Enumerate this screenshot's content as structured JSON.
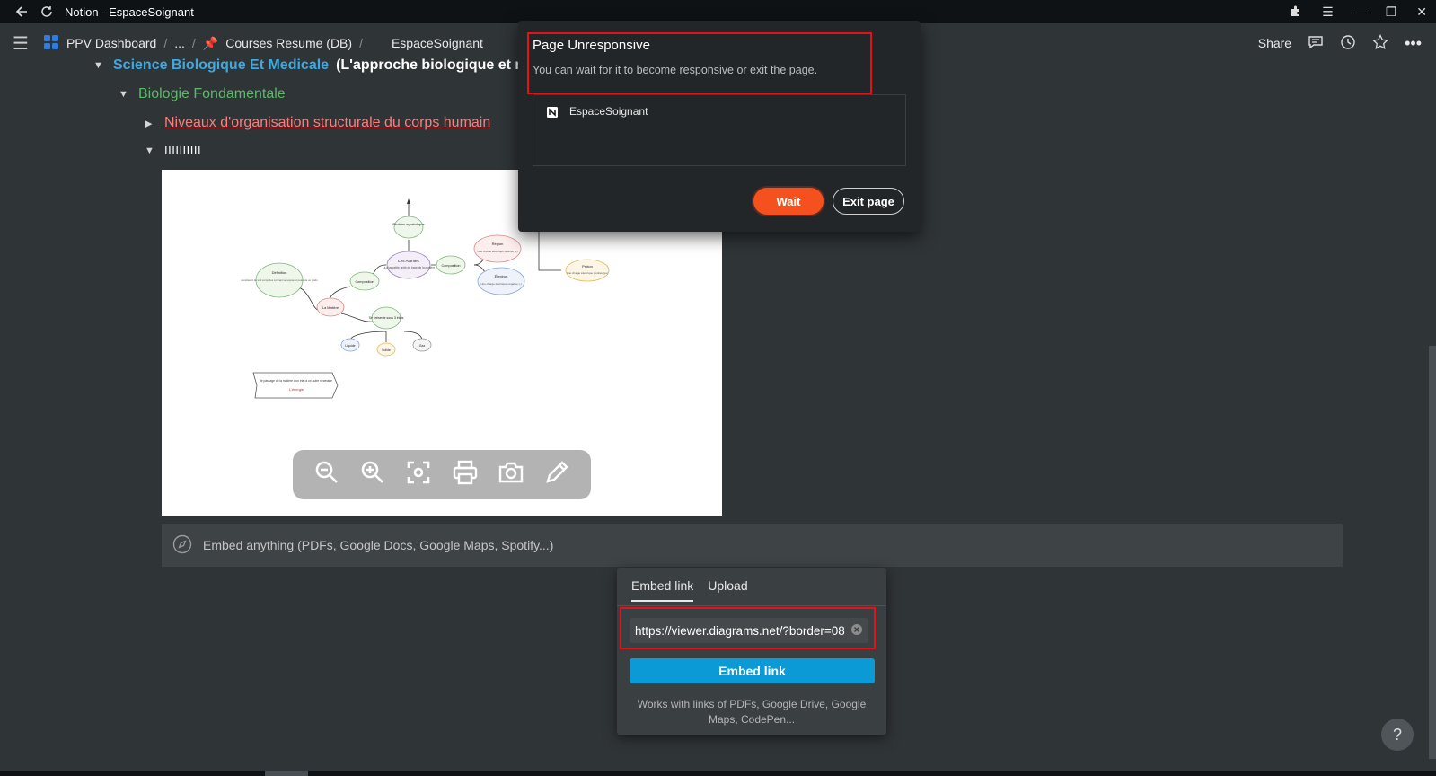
{
  "window": {
    "title": "Notion - EspaceSoignant"
  },
  "breadcrumb": {
    "workspace": "PPV Dashboard",
    "ellipsis": "...",
    "parent": "Courses Resume (DB)",
    "current": "EspaceSoignant"
  },
  "topbar": {
    "share_label": "Share"
  },
  "tree": {
    "row1_link": "Science Biologique Et Medicale",
    "row1_text": "(L'approche biologique et méd",
    "row2": "Biologie Fondamentale",
    "row3": "Niveaux d'organisation structurale du corps humain",
    "row4": "IIIIIIIIII"
  },
  "diagram": {
    "nodes": {
      "proton_top": "Protons symbolique",
      "atomes": "Les Atomes",
      "atomes_sub": "La plus petite unité de base de la matière",
      "composition_right": "Composition",
      "composition_left": "Composition",
      "region": "Région",
      "region_sub": "Une charge électrique positive (+)",
      "electron": "Électron",
      "electron_sub": "Une charge électrique négative (-)",
      "proton": "Proton",
      "proton_sub": "Une charge électrique positive (p+)",
      "definition": "Définition",
      "definition_sub": "constituant de tout corps des concept se repose et possède un poids",
      "matiere": "La Matière",
      "etats": "Se présente sous 3 états",
      "liquide": "Liquide",
      "solide": "Solide",
      "gaz": "Gaz",
      "note": "le passage de la matière d'un état à un autre nécessite",
      "note_red": "L'énergie"
    }
  },
  "embed": {
    "placeholder_text": "Embed anything (PDFs, Google Docs, Google Maps, Spotify...)",
    "tabs": [
      "Embed link",
      "Upload"
    ],
    "url_value": "https://viewer.diagrams.net/?border=08",
    "button_label": "Embed link",
    "hint": "Works with links of PDFs, Google Drive, Google Maps, CodePen..."
  },
  "dialog": {
    "title": "Page Unresponsive",
    "message": "You can wait for it to become responsive or exit the page.",
    "page_name": "EspaceSoignant",
    "wait_label": "Wait",
    "exit_label": "Exit page"
  },
  "help_label": "?",
  "colors": {
    "accent_orange": "#f4511e",
    "embed_blue": "#0b9ad6",
    "highlight_red": "#e2141a",
    "link_blue": "#3ea8e0",
    "green_text": "#5fb86c",
    "pink_link": "#ff7b7b"
  },
  "icons": [
    "back-arrow-icon",
    "reload-icon",
    "extensions-icon",
    "menu-lines-icon",
    "minimize-icon",
    "restore-icon",
    "close-icon",
    "hamburger-icon",
    "notion-dashboard-icon",
    "pin-icon",
    "comment-icon",
    "history-icon",
    "star-icon",
    "more-icon",
    "zoom-out-icon",
    "zoom-in-icon",
    "fit-icon",
    "print-icon",
    "camera-icon",
    "edit-icon",
    "compass-icon",
    "notion-logo-icon",
    "clear-icon"
  ]
}
